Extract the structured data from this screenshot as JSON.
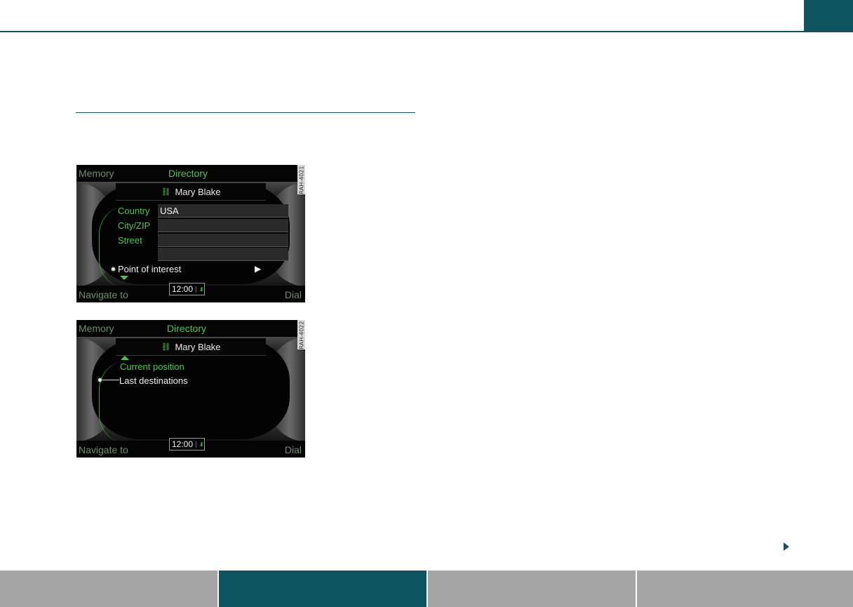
{
  "screens": [
    {
      "id": "RAH-4021",
      "top_left": "Memory",
      "top_center": "Directory",
      "contact_name": "Mary Blake",
      "fields": [
        {
          "label": "Country",
          "value": "USA"
        },
        {
          "label": "City/ZIP",
          "value": ""
        },
        {
          "label": "Street",
          "value": ""
        },
        {
          "label": "",
          "value": ""
        }
      ],
      "selected_item": "Point of interest",
      "clock": "12:00",
      "bottom_left": "Navigate to",
      "bottom_right": "Dial"
    },
    {
      "id": "RAH-4022",
      "top_left": "Memory",
      "top_center": "Directory",
      "contact_name": "Mary Blake",
      "items": [
        "Current position",
        "Last destinations"
      ],
      "clock": "12:00",
      "bottom_left": "Navigate to",
      "bottom_right": "Dial"
    }
  ],
  "footer_tabs": [
    {
      "label": "",
      "active": false
    },
    {
      "label": "",
      "active": true
    },
    {
      "label": "",
      "active": false
    },
    {
      "label": "",
      "active": false
    }
  ],
  "colors": {
    "brand_teal": "#0e5560",
    "tab_gray": "#a5a5a5",
    "mmi_green": "#4cc64c"
  },
  "icons": {
    "contact": "car-contact-icon",
    "next": "next-page-arrow-icon"
  }
}
